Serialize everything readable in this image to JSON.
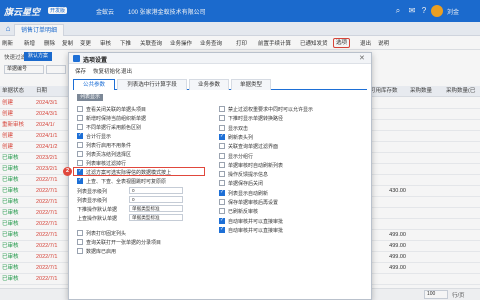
{
  "topbar": {
    "brand": "旗云星空",
    "badge": "开发版",
    "account": "金蚁云",
    "company": "100 张家港金蚁技术有限公司",
    "user": "刘金"
  },
  "tabs": [
    "销售订单明细"
  ],
  "toolbar": {
    "items": [
      "刷新",
      "新增",
      "删除",
      "复制",
      "变更",
      "审核",
      "下推",
      "关联查询",
      "业务操作",
      "业务查询",
      "打印",
      "前置手续计算",
      "已通知发货",
      "选项",
      "退出",
      "说明"
    ],
    "options_label": "选项"
  },
  "filter": {
    "scheme_label": "快速过滤",
    "scheme_default": "默认方案",
    "scheme_custom": "方案",
    "field_label": "单据编号",
    "field_value": "",
    "search_button": "搜索"
  },
  "table": {
    "headers": [
      "单据状态",
      "日期",
      "",
      "",
      "",
      "",
      "",
      "",
      "",
      "",
      "可用库存数",
      "采购数量",
      "采购数量(已"
    ],
    "rows": [
      {
        "status": "创建",
        "date": "2024/3/1",
        "stock": "",
        "qty": "",
        "qty2": ""
      },
      {
        "status": "创建",
        "date": "2024/3/1",
        "stock": "",
        "qty": "",
        "qty2": ""
      },
      {
        "status": "重新审核",
        "date": "2024/1/",
        "stock": "",
        "qty": "",
        "qty2": ""
      },
      {
        "status": "创建",
        "date": "2024/1/1",
        "stock": "",
        "qty": "",
        "qty2": ""
      },
      {
        "status": "创建",
        "date": "2024/1/2",
        "stock": "",
        "qty": "",
        "qty2": ""
      },
      {
        "status": "已审核",
        "date": "2023/2/1",
        "stock": "",
        "qty": "",
        "qty2": ""
      },
      {
        "status": "已审核",
        "date": "2023/2/1",
        "stock": "",
        "qty": "",
        "qty2": ""
      },
      {
        "status": "已审核",
        "date": "2022/7/1",
        "stock": "",
        "qty": "",
        "qty2": ""
      },
      {
        "status": "已审核",
        "date": "2022/7/1",
        "stock": "430.00",
        "qty": "",
        "qty2": ""
      },
      {
        "status": "已审核",
        "date": "2022/7/1",
        "stock": "",
        "qty": "",
        "qty2": ""
      },
      {
        "status": "已审核",
        "date": "2022/7/1",
        "stock": "",
        "qty": "",
        "qty2": ""
      },
      {
        "status": "已审核",
        "date": "2022/7/1",
        "stock": "",
        "qty": "",
        "qty2": ""
      },
      {
        "status": "已审核",
        "date": "2022/7/1",
        "stock": "499.00",
        "qty": "",
        "qty2": ""
      },
      {
        "status": "已审核",
        "date": "2022/7/1",
        "stock": "499.00",
        "qty": "",
        "qty2": ""
      },
      {
        "status": "已审核",
        "date": "2022/7/1",
        "stock": "499.00",
        "qty": "",
        "qty2": ""
      },
      {
        "status": "已审核",
        "date": "2022/7/1",
        "stock": "499.00",
        "qty": "",
        "qty2": ""
      },
      {
        "status": "已审核",
        "date": "2022/7/1",
        "stock": "",
        "qty": "",
        "qty2": ""
      }
    ]
  },
  "pagination": {
    "page_size": "100",
    "unit": "行/页"
  },
  "modal": {
    "title": "选项设置",
    "menu": [
      "保存",
      "恢复初始化",
      "退出"
    ],
    "tabs": [
      "公共参数",
      "列表选中行计算字段",
      "业务参数",
      "单据类型"
    ],
    "section": "列表显示",
    "left_options": [
      {
        "label": "查看关闭关联的单据头项目",
        "checked": false
      },
      {
        "label": "新增时保持当前组织新单据",
        "checked": false
      },
      {
        "label": "不同单据行采用颜色区别",
        "checked": false
      },
      {
        "label": "合计行显示",
        "checked": true
      },
      {
        "label": "列表行启用不用条件",
        "checked": false
      },
      {
        "label": "列表页冻结列选择区",
        "checked": false
      },
      {
        "label": "列表审核过滤掉行",
        "checked": false
      },
      {
        "label": "过滤方案可选实际得信的数据模式按上",
        "checked": true
      },
      {
        "label": "上查、下查、全表视图跳时可复原原",
        "checked": true
      }
    ],
    "right_options": [
      {
        "label": "禁止过滤权重要求中同时可以允许显示",
        "checked": false
      },
      {
        "label": "下推时显示单据转换路径",
        "checked": false
      },
      {
        "label": "显示双击",
        "checked": false
      },
      {
        "label": "刷新表头列",
        "checked": true
      },
      {
        "label": "关联查询单据过滤界面",
        "checked": false
      },
      {
        "label": "显示分组行",
        "checked": false
      },
      {
        "label": "单据审核时自动刷新列表",
        "checked": false
      },
      {
        "label": "操作反馈提示信息",
        "checked": false
      },
      {
        "label": "单据保存后关闭",
        "checked": false
      },
      {
        "label": "列表显示自动刷新",
        "checked": true
      },
      {
        "label": "保存单据审核后再设置",
        "checked": false
      },
      {
        "label": "已刷新反审核",
        "checked": false
      },
      {
        "label": "自动审核并可以直接审批",
        "checked": true
      },
      {
        "label": "自动审核并可以直接审批",
        "checked": true
      }
    ],
    "fields": [
      {
        "label": "列表显示级列",
        "value": "0"
      },
      {
        "label": "列表显示级列",
        "value": "0"
      },
      {
        "label": "下推操作默认单据",
        "value": "单据类型标准"
      },
      {
        "label": "上查操作默认单据",
        "value": "单据类型标准"
      }
    ],
    "bottom_options": [
      {
        "label": "列表打印固定列头",
        "checked": false
      },
      {
        "label": "查询关联打开一张单据的分录项目",
        "checked": false
      },
      {
        "label": "数据库已启用",
        "checked": false
      }
    ],
    "marker_text": "2"
  },
  "colors": {
    "brand": "#1d6fd6",
    "accent_red": "#e0473c",
    "approved": "#1a9b45"
  }
}
